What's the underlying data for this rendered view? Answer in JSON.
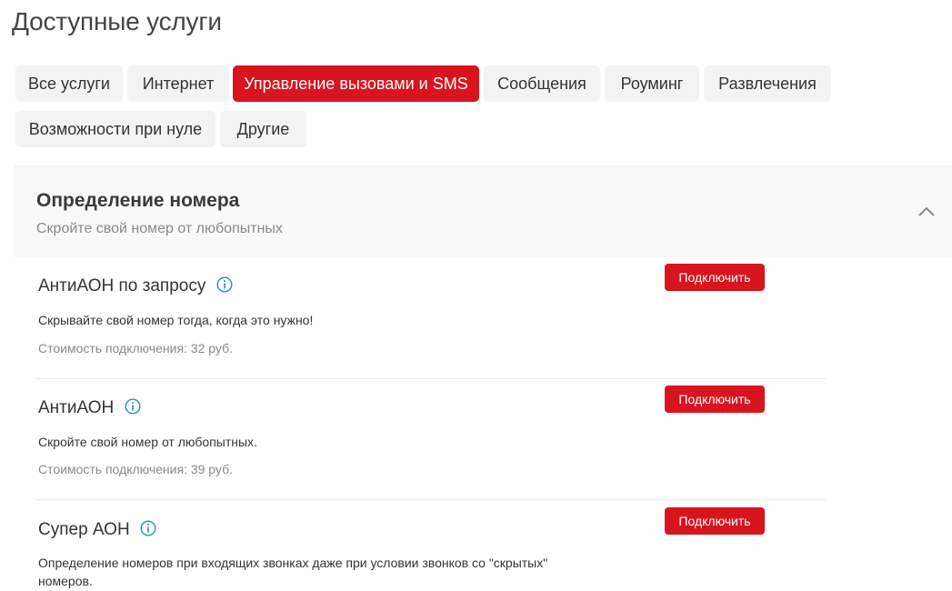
{
  "page": {
    "title": "Доступные услуги"
  },
  "tabs": [
    {
      "label": "Все услуги",
      "active": false
    },
    {
      "label": "Интернет",
      "active": false
    },
    {
      "label": "Управление вызовами и SMS",
      "active": true
    },
    {
      "label": "Сообщения",
      "active": false
    },
    {
      "label": "Роуминг",
      "active": false
    },
    {
      "label": "Развлечения",
      "active": false
    },
    {
      "label": "Возможности при нуле",
      "active": false
    },
    {
      "label": "Другие",
      "active": false
    }
  ],
  "section": {
    "title": "Определение номера",
    "subtitle": "Скройте свой номер от любопытных",
    "expanded": true,
    "services": [
      {
        "name": "АнтиАОН по запросу",
        "description": "Скрывайте свой номер тогда, когда это нужно!",
        "cost": "Стоимость подключения: 32 руб.",
        "button": "Подключить"
      },
      {
        "name": "АнтиАОН",
        "description": "Скройте свой номер от любопытных.",
        "cost": "Стоимость подключения: 39 руб.",
        "button": "Подключить"
      },
      {
        "name": "Супер АОН",
        "description": "Определение номеров при входящих звонках даже при условии звонков со \"скрытых\" номеров.",
        "button": "Подключить"
      }
    ]
  },
  "colors": {
    "accent": "#d8141f",
    "tab_bg": "#f3f3f3",
    "section_bg": "#f9f9f9",
    "muted_text": "#8a8a8a",
    "info_icon": "#2a8fb8"
  },
  "icons": {
    "info": "info-icon",
    "collapse": "chevron-up-icon"
  }
}
